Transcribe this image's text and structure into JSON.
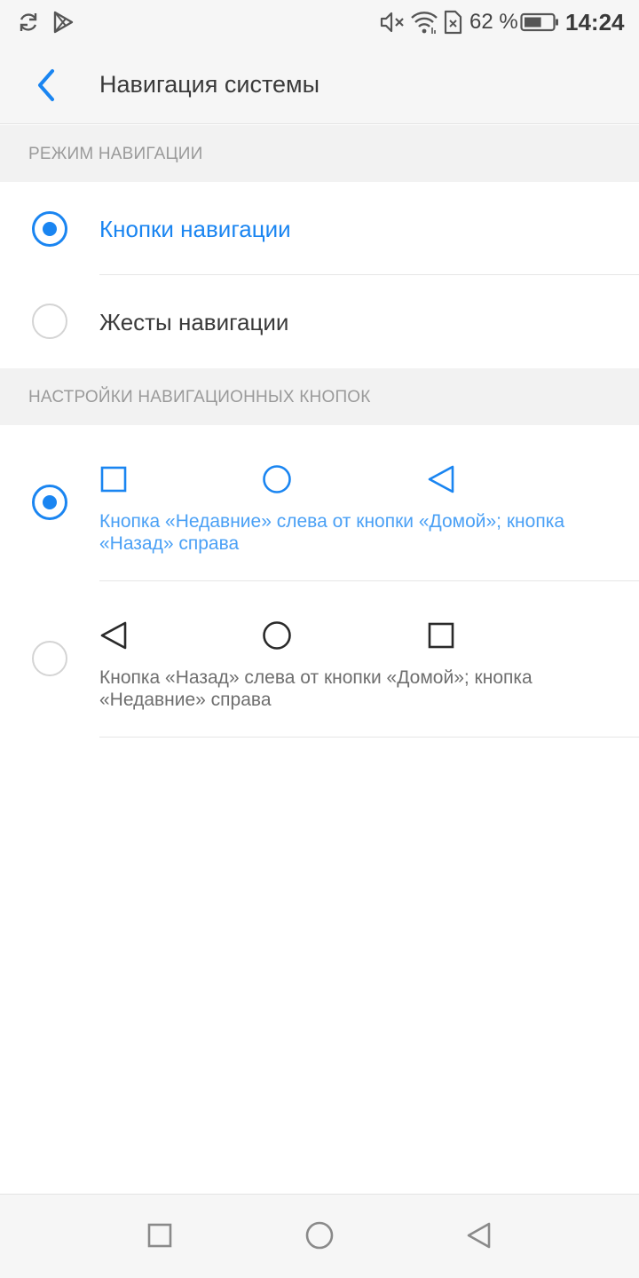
{
  "status_bar": {
    "icons": [
      "sync-icon",
      "play-store-icon",
      "mute-icon",
      "wifi-icon",
      "no-sim-icon",
      "battery-icon"
    ],
    "battery_percent": "62 %",
    "battery_level": 0.62,
    "time": "14:24"
  },
  "header": {
    "back_icon": "chevron-left-icon",
    "title": "Навигация системы"
  },
  "sections": {
    "navigation_mode": {
      "title": "РЕЖИМ НАВИГАЦИИ",
      "options": [
        {
          "label": "Кнопки навигации",
          "selected": true
        },
        {
          "label": "Жесты навигации",
          "selected": false
        }
      ]
    },
    "button_settings": {
      "title": "НАСТРОЙКИ НАВИГАЦИОННЫХ КНОПОК",
      "options": [
        {
          "icons": [
            "square-icon",
            "circle-icon",
            "triangle-left-icon"
          ],
          "description": "Кнопка «Недавние» слева от кнопки «Домой»; кнопка «Назад» справа",
          "selected": true
        },
        {
          "icons": [
            "triangle-left-icon",
            "circle-icon",
            "square-icon"
          ],
          "description": "Кнопка «Назад» слева от кнопки «Домой»; кнопка «Недавние» справа",
          "selected": false
        }
      ]
    }
  },
  "nav_bar": {
    "buttons": [
      "recents-square-icon",
      "home-circle-icon",
      "back-triangle-icon"
    ]
  },
  "colors": {
    "accent": "#1a85f1",
    "accent_light": "#4aa0f5",
    "text_primary": "#3a3a3a",
    "text_secondary": "#6e6e6e",
    "section_text": "#9a9a9a",
    "section_bg": "#f2f2f2"
  }
}
